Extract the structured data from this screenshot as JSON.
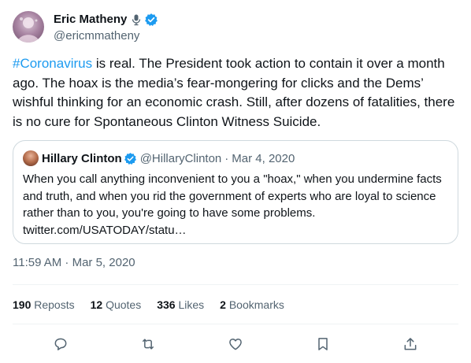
{
  "author": {
    "display_name": "Eric Matheny",
    "handle": "@ericmmatheny",
    "avatar": "avatar-image",
    "badges": [
      "microphone-icon",
      "verified-badge-icon"
    ]
  },
  "tweet": {
    "hashtag": "#Coronavirus",
    "text": " is real. The President took action to contain it over a month ago. The hoax is the media’s fear-mongering for clicks and the Dems’ wishful thinking for an economic crash. Still, after dozens of fatalities, there is no cure for Spontaneous Clinton Witness Suicide."
  },
  "quoted_tweet": {
    "display_name": "Hillary Clinton",
    "handle": "@HillaryClinton",
    "separator": "·",
    "date": "Mar 4, 2020",
    "text": "When you call anything inconvenient to you a \"hoax,\" when you undermine facts and truth, and when you rid the government of experts who are loyal to science rather than to you, you're going to have some problems.",
    "link": "twitter.com/USATODAY/statu…"
  },
  "timestamp": "11:59 AM · Mar 5, 2020",
  "stats": {
    "reposts_count": "190",
    "reposts_label": "Reposts",
    "quotes_count": "12",
    "quotes_label": "Quotes",
    "likes_count": "336",
    "likes_label": "Likes",
    "bookmarks_count": "2",
    "bookmarks_label": "Bookmarks"
  },
  "actions": [
    "reply-icon",
    "repost-icon",
    "like-icon",
    "bookmark-icon",
    "share-icon"
  ],
  "colors": {
    "accent": "#1d9bf0",
    "text_primary": "#0f1419",
    "text_secondary": "#536471",
    "border": "#cfd9de"
  }
}
